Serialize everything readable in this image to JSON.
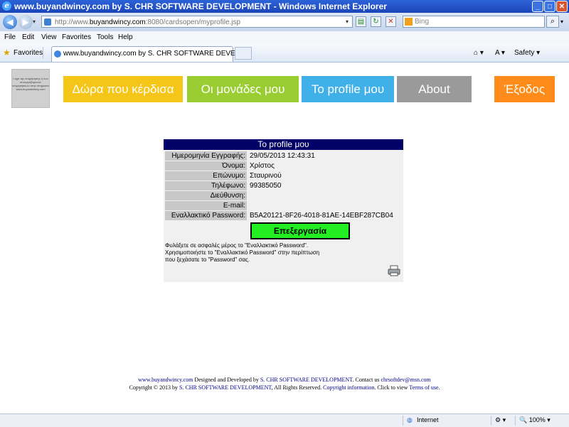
{
  "window": {
    "title": "www.buyandwincy.com by S. CHR SOFTWARE DEVELOPMENT - Windows Internet Explorer"
  },
  "address": {
    "url_prefix": "http://www.",
    "url_domain": "buyandwincy.com",
    "url_rest": ":8080/cardsopen/myprofile.jsp"
  },
  "search": {
    "placeholder": "Bing"
  },
  "menu": [
    "File",
    "Edit",
    "View",
    "Favorites",
    "Tools",
    "Help"
  ],
  "favorites": {
    "label": "Favorites",
    "tab_title": "www.buyandwincy.com by S. CHR SOFTWARE DEVEL...",
    "safety_label": "Safety"
  },
  "logo": {
    "text": "Logo της επιχείρησης ή των συνεργαζόμενων επιχειρήσεων στην υπηρεσία www.buyandwincy.com"
  },
  "nav": [
    {
      "label": "Δώρα που κέρδισα",
      "color": "#f5c518"
    },
    {
      "label": "Οι μονάδες μου",
      "color": "#9acd32"
    },
    {
      "label": "Το profile μου",
      "color": "#3fb0e8"
    },
    {
      "label": "About",
      "color": "#9a9a9a"
    },
    {
      "label": "Έξοδος",
      "color": "#ff8c1a"
    }
  ],
  "profile": {
    "title": "Το profile μου",
    "rows": [
      {
        "key": "Ημερομηνία Εγγραφής:",
        "value": "29/05/2013 12:43:31"
      },
      {
        "key": "Όνομα:",
        "value": "Χρίστος"
      },
      {
        "key": "Επώνυμο:",
        "value": "Σταυρινού"
      },
      {
        "key": "Τηλέφωνο:",
        "value": "99385050"
      },
      {
        "key": "Διεύθυνση:",
        "value": ""
      },
      {
        "key": "E-mail:",
        "value": ""
      },
      {
        "key": "Εναλλακτικό Password:",
        "value": "B5A20121-8F26-4018-81AE-14EBF287CB04"
      }
    ],
    "edit_label": "Επεξεργασία",
    "note_line1": "Φυλάξετε σε ασφαλές μέρος το \"Εναλλακτικό Password\".",
    "note_line2": "Χρησιμοποιήστε το \"Εναλλακτικό Password\" στην περίπτωση",
    "note_line3": "που ξεχάσατε το \"Password\" σας."
  },
  "footer": {
    "site_link": "www.buyandwincy.com",
    "designed_by": " Designed and Developed by ",
    "company_link": "S. CHR SOFTWARE DEVELOPMENT",
    "contact": ". Contact us ",
    "email_link": "chrsoftdev@msn.com",
    "copyright": "Copyright © 2013 by ",
    "company_link2": "S. CHR SOFTWARE DEVELOPMENT",
    "rights": ", All Rights Reserved. ",
    "copyright_info_link": "Copyright information",
    "click_view": ". Click to view ",
    "terms_link": "Terms of use",
    "period": "."
  },
  "status": {
    "zone": "Internet",
    "zoom": "100%"
  }
}
